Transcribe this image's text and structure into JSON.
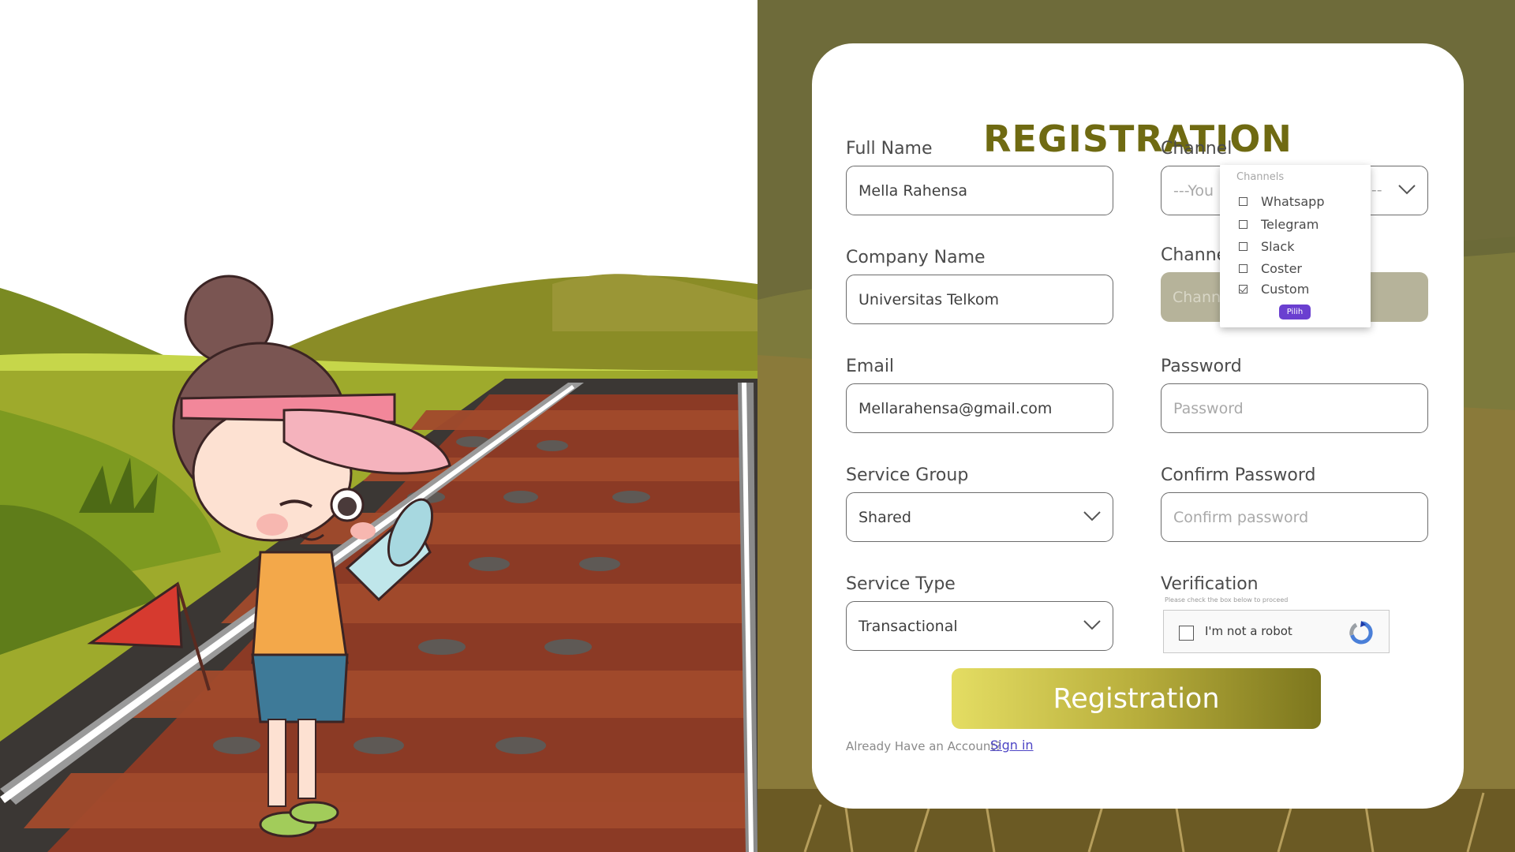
{
  "form": {
    "title": "REGISTRATION",
    "full_name": {
      "label": "Full Name",
      "value": "Mella Rahensa"
    },
    "company_name": {
      "label": "Company Name",
      "value": "Universitas Telkom"
    },
    "email": {
      "label": "Email",
      "value": "Mellarahensa@gmail.com"
    },
    "service_group": {
      "label": "Service Group",
      "selected": "Shared"
    },
    "service_type": {
      "label": "Service Type",
      "selected": "Transactional"
    },
    "channel": {
      "label": "Channel",
      "placeholder_left": "---You",
      "placeholder_right": "---"
    },
    "channel_disabled": {
      "label": "Channel",
      "placeholder": "Channel"
    },
    "password": {
      "label": "Password",
      "placeholder": "Password"
    },
    "confirm_password": {
      "label": "Confirm Password",
      "placeholder": "Confirm password"
    },
    "verification": {
      "label": "Verification",
      "note": "Please check the box below to proceed",
      "captcha_text": "I'm not a robot",
      "checked": false
    },
    "submit_label": "Registration",
    "footer": {
      "text": "Already Have an Account?",
      "link": "Sign in"
    }
  },
  "channel_popup": {
    "header": "Channels",
    "options": [
      {
        "label": "Whatsapp",
        "checked": false
      },
      {
        "label": "Telegram",
        "checked": false
      },
      {
        "label": "Slack",
        "checked": false
      },
      {
        "label": "Coster",
        "checked": false
      },
      {
        "label": "Custom",
        "checked": true
      }
    ],
    "button": "Pilih"
  },
  "colors": {
    "title": "#6f6a12",
    "button_gradient_start": "#e4dd63",
    "button_gradient_end": "#7c761d",
    "panel_bg": "#6b6a38",
    "link": "#4d45c5",
    "pilih_button": "#6a3fd0"
  }
}
